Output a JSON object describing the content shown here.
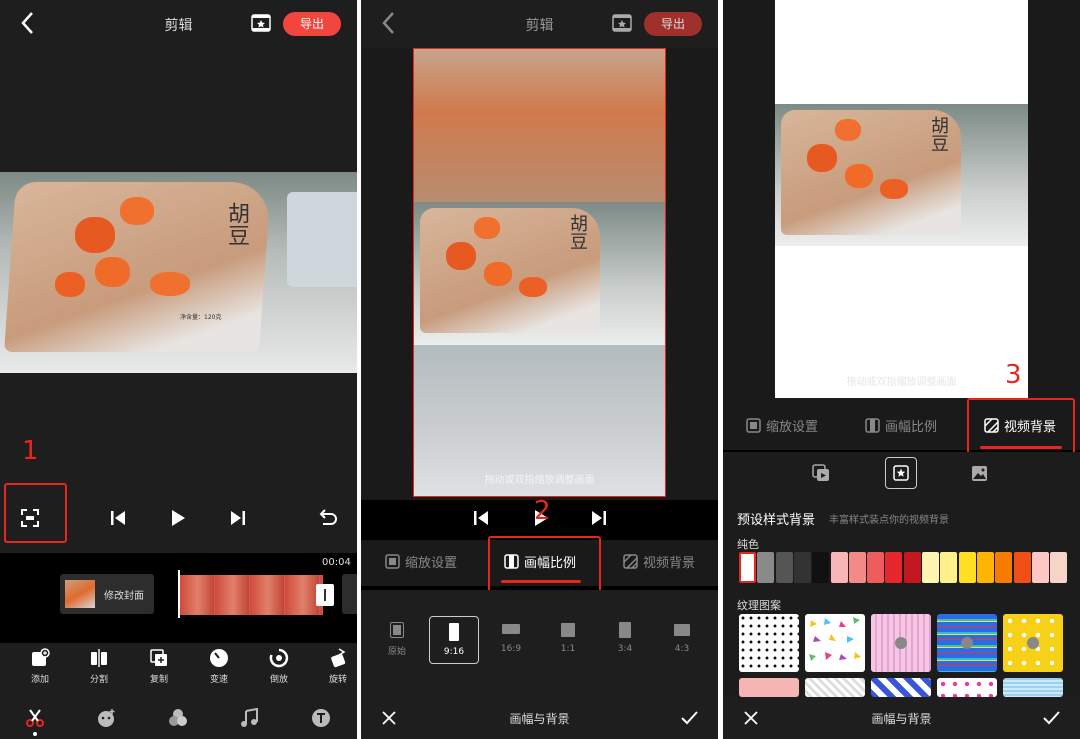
{
  "panel1": {
    "title": "剪辑",
    "export_label": "导出",
    "step_number": "1",
    "timeline_time": "00:04",
    "cover_label": "修改封面",
    "tools": [
      {
        "label": "添加",
        "icon": "add-clip-icon"
      },
      {
        "label": "分割",
        "icon": "split-icon"
      },
      {
        "label": "复制",
        "icon": "copy-icon"
      },
      {
        "label": "变速",
        "icon": "speed-icon"
      },
      {
        "label": "倒放",
        "icon": "reverse-icon"
      },
      {
        "label": "旋转",
        "icon": "rotate-icon"
      }
    ],
    "bottom_nav": [
      "scissors-icon",
      "sticker-icon",
      "filter-icon",
      "music-icon",
      "text-icon"
    ]
  },
  "panel2": {
    "title": "剪辑",
    "export_label": "导出",
    "hint": "拖动或双指缩放调整画面",
    "step_number": "2",
    "tabs": [
      {
        "label": "缩放设置",
        "icon": "zoom-settings-icon"
      },
      {
        "label": "画幅比例",
        "icon": "aspect-ratio-icon"
      },
      {
        "label": "视频背景",
        "icon": "video-background-icon"
      }
    ],
    "ratios": [
      "原始",
      "9:16",
      "16:9",
      "1:1",
      "3:4",
      "4:3"
    ],
    "selected_ratio": "9:16",
    "bottom_title": "画幅与背景"
  },
  "panel3": {
    "hint": "拖动或双指缩放调整画面",
    "step_number": "3",
    "tabs": [
      {
        "label": "缩放设置",
        "icon": "zoom-settings-icon"
      },
      {
        "label": "画幅比例",
        "icon": "aspect-ratio-icon"
      },
      {
        "label": "视频背景",
        "icon": "video-background-icon"
      }
    ],
    "bg_types": [
      "blur-background-icon",
      "preset-style-icon",
      "image-background-icon"
    ],
    "preset_title": "预设样式背景",
    "preset_subtitle": "丰富样式装点你的视频背景",
    "solid_label": "纯色",
    "texture_label": "纹理图案",
    "solid_colors": [
      "#ffffff",
      "#8a8a8a",
      "#555555",
      "#333333",
      "#111111",
      "#f8b6b6",
      "#f48a88",
      "#ee5c5c",
      "#e8262e",
      "#c41820",
      "#fff4b0",
      "#ffef8a",
      "#ffe020",
      "#ffb400",
      "#f57c00",
      "#f04f16",
      "#ffc6c6",
      "#f7d4c8"
    ],
    "bottom_title": "画幅与背景",
    "accent": "#e8261e"
  },
  "product_text": {
    "brand": "胡豆",
    "small": "净含量：120克"
  }
}
